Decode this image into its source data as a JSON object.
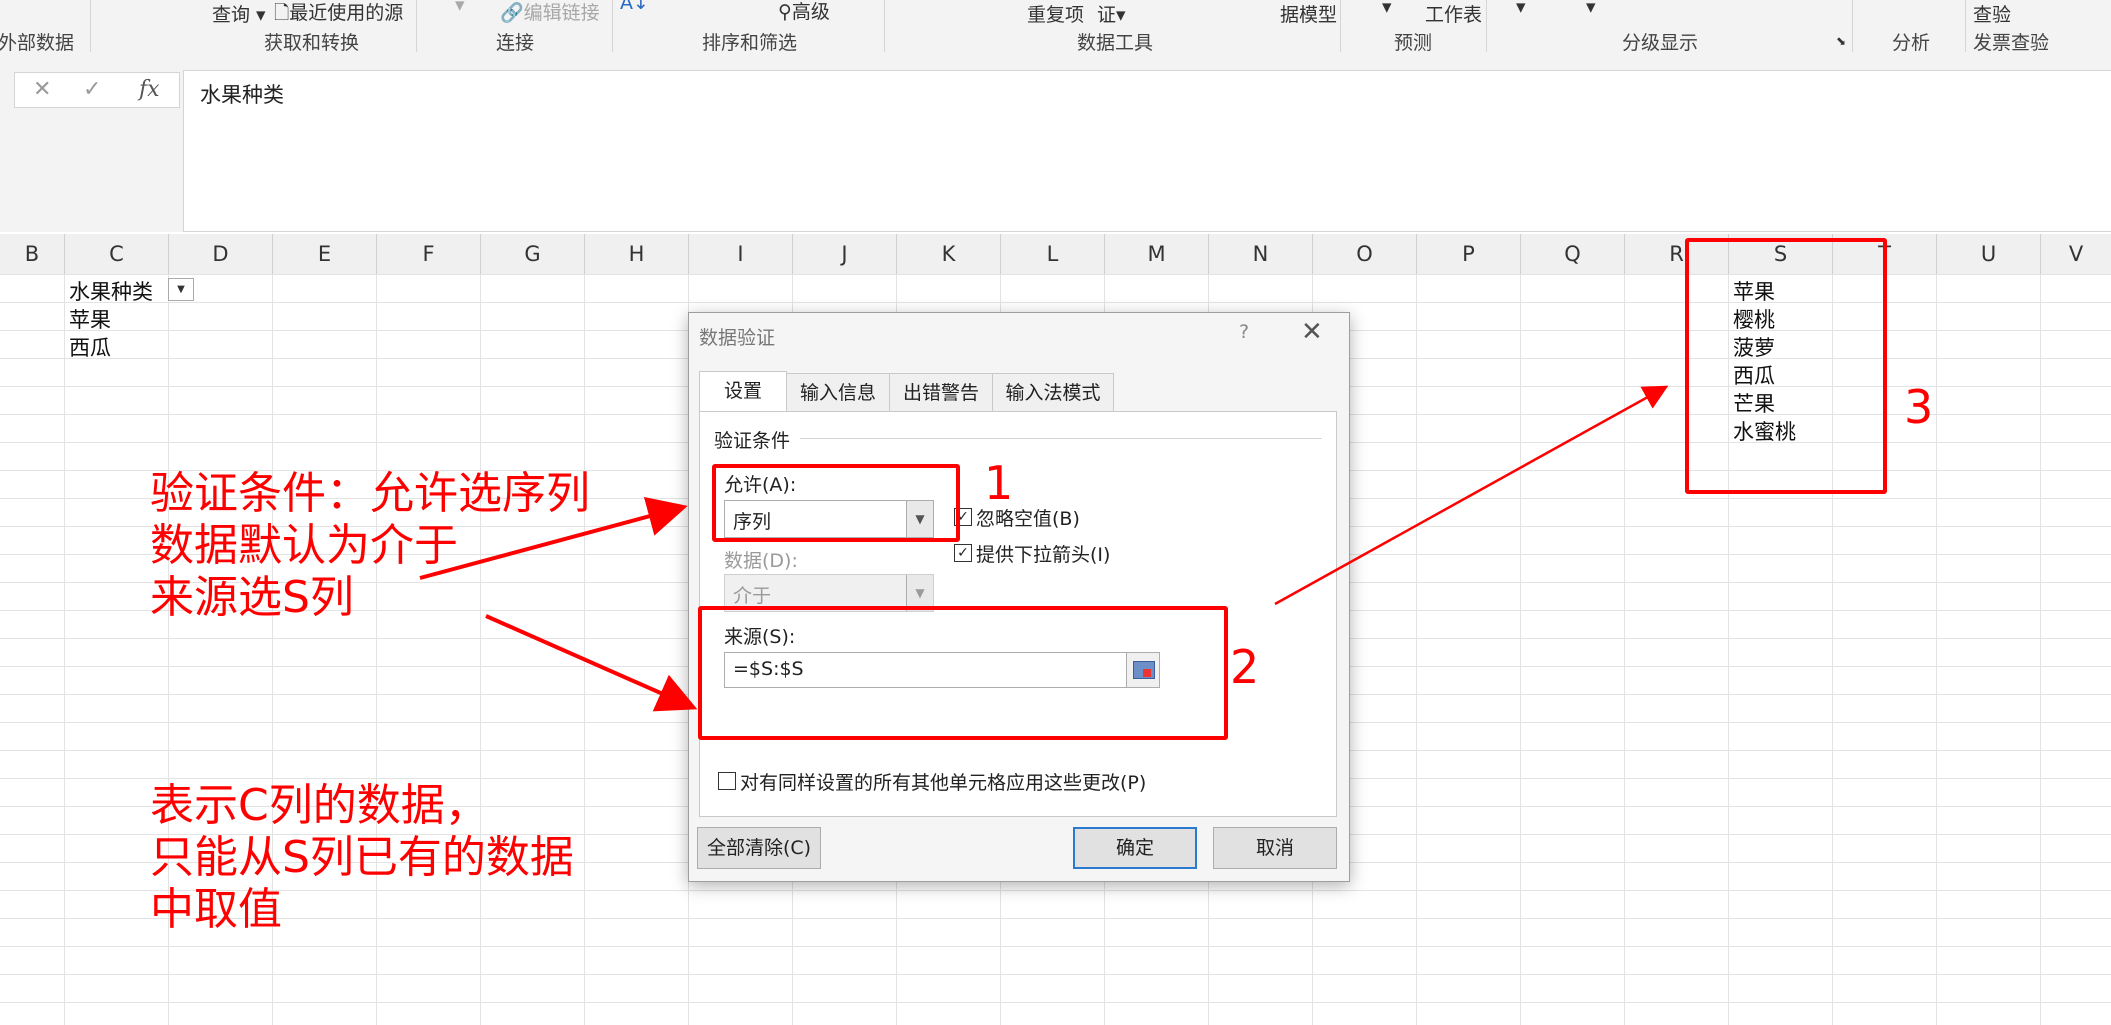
{
  "ribbon": {
    "items": {
      "query": "查询",
      "recent_sources": "最近使用的源",
      "edit_links": "编辑链接",
      "advanced": "高级",
      "duplicates": "重复项",
      "verify": "证",
      "data_model": "据模型",
      "worksheet": "工作表",
      "check": "查验"
    },
    "groups": {
      "external_data": "外部数据",
      "get_transform": "获取和转换",
      "connections": "连接",
      "sort_filter": "排序和筛选",
      "data_tools": "数据工具",
      "forecast": "预测",
      "outline": "分级显示",
      "analysis": "分析",
      "invoice_check": "发票查验"
    }
  },
  "formula_bar": {
    "cancel_glyph": "✕",
    "enter_glyph": "✓",
    "fx": "fx",
    "content": "水果种类"
  },
  "columns": [
    "B",
    "C",
    "D",
    "E",
    "F",
    "G",
    "H",
    "I",
    "J",
    "K",
    "L",
    "M",
    "N",
    "O",
    "P",
    "Q",
    "R",
    "S",
    "T",
    "U",
    "V"
  ],
  "cells": {
    "c1": "水果种类",
    "c2": "苹果",
    "c3": "西瓜",
    "s_list": [
      "苹果",
      "樱桃",
      "菠萝",
      "西瓜",
      "芒果",
      "水蜜桃"
    ]
  },
  "dialog": {
    "title": "数据验证",
    "help": "?",
    "close": "✕",
    "tabs": [
      "设置",
      "输入信息",
      "出错警告",
      "输入法模式"
    ],
    "section": "验证条件",
    "allow_label": "允许(A):",
    "allow_value": "序列",
    "ignore_blank": "忽略空值(B)",
    "dropdown_arrow": "提供下拉箭头(I)",
    "data_label": "数据(D):",
    "data_value": "介于",
    "source_label": "来源(S):",
    "source_value": "=$S:$S",
    "apply_all": "对有同样设置的所有其他单元格应用这些更改(P)",
    "clear_all": "全部清除(C)",
    "ok": "确定",
    "cancel": "取消"
  },
  "annotations": {
    "num1": "1",
    "num2": "2",
    "num3": "3",
    "note1_lines": [
      "验证条件：允许选序列",
      "数据默认为介于",
      "来源选S列"
    ],
    "note2_lines": [
      "表示C列的数据，",
      "只能从S列已有的数据",
      "中取值"
    ],
    "color": "#ff0000"
  }
}
